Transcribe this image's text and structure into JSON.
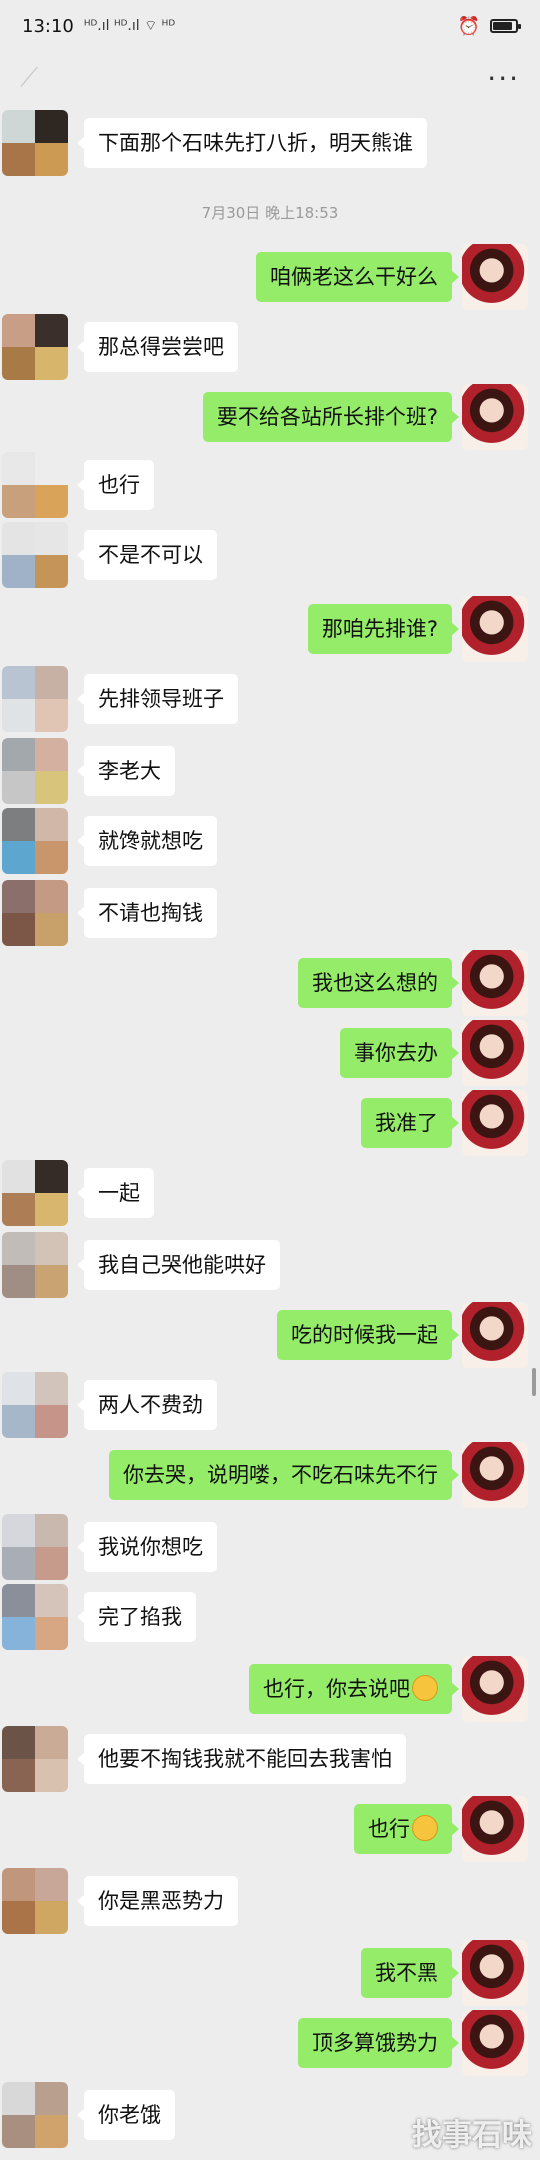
{
  "status_bar": {
    "time": "13:10",
    "signal_icons": "ᴴᴰ.ıl ᴴᴰ.ıl ⌔ ᴴᴰ",
    "alarm_icon": "alarm-icon",
    "battery_icon": "battery-icon",
    "battery_level": 0.85
  },
  "header": {
    "back_icon": "back-arrow-icon",
    "more_icon": "more-icon",
    "more_label": "···"
  },
  "timestamp": "7月30日 晚上18:53",
  "messages": [
    {
      "side": "left",
      "text": "下面那个石味先打八折，明天熊谁",
      "colors": [
        "#cfd6d6",
        "#2f2722",
        "#a87549",
        "#cd9a53"
      ]
    },
    {
      "side": "right",
      "text": "咱俩老这么干好么"
    },
    {
      "side": "left",
      "text": "那总得尝尝吧",
      "colors": [
        "#c89e86",
        "#3b2f2b",
        "#a87a45",
        "#d7b56a"
      ]
    },
    {
      "side": "right",
      "text": "要不给各站所长排个班?"
    },
    {
      "side": "left",
      "text": "也行",
      "colors": [
        "#e8e8e8",
        "#ededed",
        "#c9a07c",
        "#d9a35a"
      ]
    },
    {
      "side": "left",
      "text": "不是不可以",
      "colors": [
        "#e4e4e4",
        "#e6e6e6",
        "#9fb2c8",
        "#c59557"
      ]
    },
    {
      "side": "right",
      "text": "那咱先排谁?"
    },
    {
      "side": "left",
      "text": "先排领导班子",
      "colors": [
        "#b8c4d2",
        "#c7b1a4",
        "#dfe3e6",
        "#e0c5b4"
      ]
    },
    {
      "side": "left",
      "text": "李老大",
      "colors": [
        "#a3a8ad",
        "#d3b09f",
        "#c6c6c6",
        "#d8c47a"
      ]
    },
    {
      "side": "left",
      "text": "就馋就想吃",
      "colors": [
        "#7d7e80",
        "#d0b7a8",
        "#5ca6d0",
        "#c9966c"
      ]
    },
    {
      "side": "left",
      "text": "不请也掏钱",
      "colors": [
        "#8b6f6a",
        "#c49a84",
        "#7c5747",
        "#c8a069"
      ]
    },
    {
      "side": "right",
      "text": "我也这么想的"
    },
    {
      "side": "right",
      "text": "事你去办"
    },
    {
      "side": "right",
      "text": "我准了"
    },
    {
      "side": "left",
      "text": "一起",
      "colors": [
        "#e1e1e1",
        "#362c27",
        "#ad7d55",
        "#d8b66e"
      ]
    },
    {
      "side": "left",
      "text": "我自己哭他能哄好",
      "colors": [
        "#c2bcb8",
        "#d3c2b6",
        "#a08d84",
        "#caa373"
      ]
    },
    {
      "side": "right",
      "text": "吃的时候我一起"
    },
    {
      "side": "left",
      "text": "两人不费劲",
      "colors": [
        "#dfe2e6",
        "#d2c3bb",
        "#a6b7c9",
        "#c79489"
      ]
    },
    {
      "side": "right",
      "text": "你去哭，说明喽，不吃石味先不行"
    },
    {
      "side": "left",
      "text": "我说你想吃",
      "colors": [
        "#d5d7dc",
        "#c9b8ae",
        "#a9aeb6",
        "#c79b8c"
      ]
    },
    {
      "side": "left",
      "text": "完了掐我",
      "colors": [
        "#8a8f99",
        "#d5c4ba",
        "#86b3d9",
        "#d7a783"
      ]
    },
    {
      "side": "right",
      "text": "也行，你去说吧",
      "emoji": "grin-emoji"
    },
    {
      "side": "left",
      "text": "他要不掏钱我就不能回去我害怕",
      "colors": [
        "#6b5347",
        "#c9ab96",
        "#8a6453",
        "#d9c1b0"
      ]
    },
    {
      "side": "right",
      "text": "也行",
      "emoji": "smirk-emoji"
    },
    {
      "side": "left",
      "text": "你是黑恶势力",
      "colors": [
        "#c0977c",
        "#c8a698",
        "#aa7448",
        "#cfa763"
      ]
    },
    {
      "side": "right",
      "text": "我不黑"
    },
    {
      "side": "right",
      "text": "顶多算饿势力"
    },
    {
      "side": "left",
      "text": "你老饿",
      "colors": [
        "#d8d8d8",
        "#b9a08e",
        "#a88f80",
        "#cfa36b"
      ]
    }
  ],
  "watermark": "找事石味"
}
